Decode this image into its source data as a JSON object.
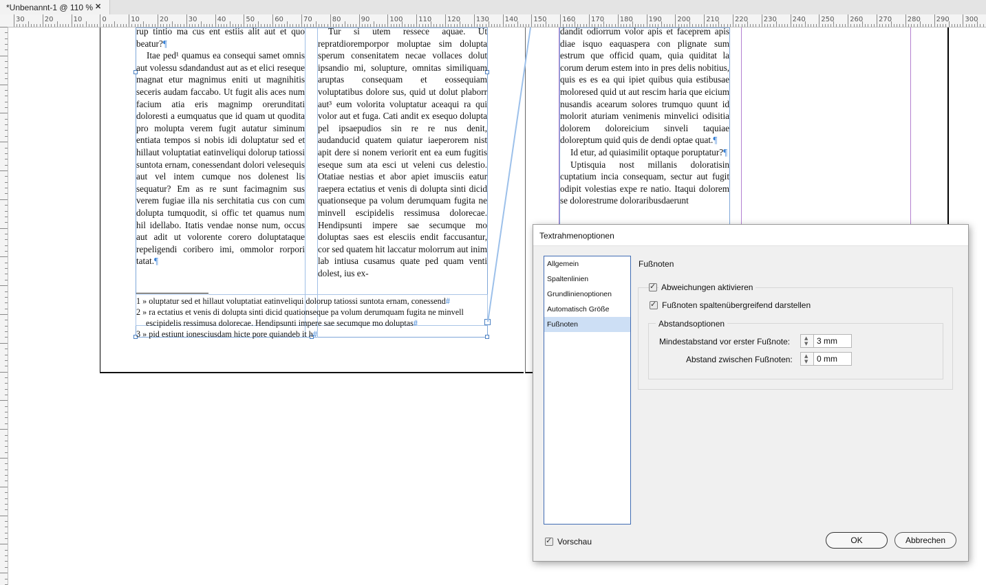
{
  "document_tab": {
    "title": "*Unbenannt-1 @ 110 %",
    "close_glyph": "✕"
  },
  "ruler": {
    "labels": [
      "30",
      "20",
      "10",
      "0",
      "10",
      "20",
      "30",
      "40",
      "50",
      "60",
      "70",
      "80",
      "90",
      "100",
      "110",
      "120",
      "130",
      "140",
      "150",
      "160",
      "170",
      "180",
      "190",
      "200",
      "210",
      "220",
      "230",
      "240",
      "250",
      "260",
      "270",
      "280",
      "290",
      "300"
    ]
  },
  "page_left": {
    "col1": [
      {
        "text": "rup tintio ma cus ent estiis alit aut et quo beatur?",
        "indent": false
      },
      {
        "text": "Itae ped¹ quamus ea consequi samet omnis aut volessu sdandandust aut as et elici reseque magnat etur magnimus eniti ut magnihitis seceris audam faccabo. Ut fugit alis aces num facium atia eris magnimp orerunditati doloresti a eumquatus que id quam ut quodita pro molupta verem fugit autatur siminum entiata tempos si nobis idi doluptatur sed et hillaut voluptatiat eatinveliqui dolorup tatiossi suntota ernam, conessendant dolori velesequis aut vel intem cumque nos dolenest lis sequatur? Em as re sunt facimagnim sus verem fugiae illa nis serchitatia cus con cum dolupta tumquodit, si offic tet quamus num hil idellabo. Itatis vendae nonse num, occus aut adit ut volorente corero doluptataque repeligendi coribero imi, ommolor rorpori tatat.",
        "indent": true
      }
    ],
    "col2": [
      {
        "text": "Tur si utem ressece aquae. Ut repratdioremporpor moluptae sim dolupta sperum consenitatem necae vollaces dolut ipsandio mi, solupture, omnitas similiquam aruptas consequam et eossequiam voluptatibus dolore sus, quid ut dolut plaborr aut³ eum volorita voluptatur aceaqui ra qui volor aut et fuga. Cati andit ex esequo dolupta pel ipsaepudios sin re re nus denit, audanducid quatem quiatur iaeperorem nist apit dere si nonem veriorit ent ea eum fugitis eseque sum ata esci ut veleni cus delestio. Otatiae nestias et abor apiet imusciis eatur raepera ectatius et venis di dolupta sinti dicid quationseque pa volum derumquam fugita ne minvell escipidelis ressimusa dolorecae. Hendipsunti impere sae secumque mo doluptas saes est elesciis endit faccusantur, cor sed quatem hit laccatur molorrum aut inim lab intiusa cusamus quate ped quam venti dolest, ius ex-",
        "indent": true
      }
    ],
    "pilcrow": "¶",
    "footnotes": [
      {
        "num": "1",
        "text": "oluptatur sed et hillaut voluptatiat eatinveliqui dolorup tatiossi suntota ernam, conessend"
      },
      {
        "num": "2",
        "text": "ra ectatius et venis di dolupta sinti dicid quationseque pa volum derumquam fugita ne minvell"
      },
      {
        "num": "",
        "text": "escipidelis ressimusa dolorecae. Hendipsunti impere sae secumque mo doluptas"
      },
      {
        "num": "3",
        "text": "pid estiunt ionesciusdam hicte pore quiandeb it h"
      }
    ],
    "footnote_mark": "#"
  },
  "page_right": {
    "col1": [
      {
        "text": "dandit odiorrum volor apis et faceprem apis diae isquo eaquaspera con plignate sum estrum que officid quam, quia quiditat la corum derum estem into in pres delis nobitius, quis es es ea qui ipiet quibus quia estibusae moloresed quid ut aut rescim haria que eicium nusandis acearum solores trumquo quunt id molorit aturiam venimenis minvelici odisitia dolorem doloreicium sinveli taquiae doloreptum quid quis de dendi optae quat.",
        "indent": false
      },
      {
        "text": "Id etur, ad quiasimilit optaque poruptatur?",
        "indent": true
      },
      {
        "text": "Uptisquia nost millanis doloratisin cuptatium incia consequam, sectur aut fugit odipit volestias expe re natio. Itaqui dolorem se dolorestrume doloraribusdaerunt",
        "indent": true
      }
    ]
  },
  "dialog": {
    "title": "Textrahmenoptionen",
    "nav": [
      "Allgemein",
      "Spaltenlinien",
      "Grundlinienoptionen",
      "Automatisch Größe ändern",
      "Fußnoten"
    ],
    "selected_nav": "Fußnoten",
    "section_title": "Fußnoten",
    "cb_deviations": "Abweichungen aktivieren",
    "cb_span": "Fußnoten spaltenübergreifend darstellen",
    "spacing_group": "Abstandsoptionen",
    "min_spacing_label": "Mindestabstand vor erster Fußnote:",
    "min_spacing_value": "3 mm",
    "between_label": "Abstand zwischen Fußnoten:",
    "between_value": "0 mm",
    "preview": "Vorschau",
    "ok": "OK",
    "cancel": "Abbrechen"
  },
  "colors": {
    "frame": "#7ea6d8",
    "margin": "#b37fd0",
    "selection": "#cddff5",
    "thread": "#9cc0ea"
  }
}
